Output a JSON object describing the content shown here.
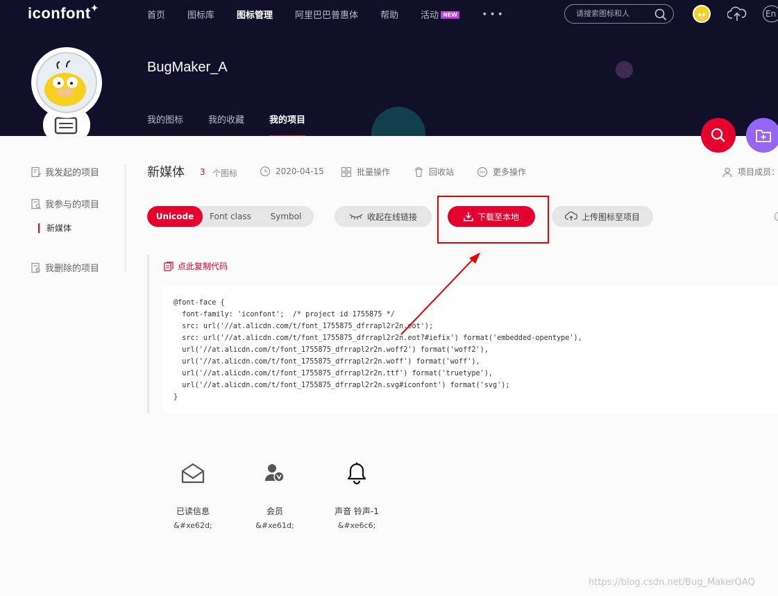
{
  "header": {
    "logo": "iconfont",
    "nav": [
      {
        "label": "首页"
      },
      {
        "label": "图标库"
      },
      {
        "label": "图标管理",
        "active": true
      },
      {
        "label": "阿里巴巴普惠体"
      },
      {
        "label": "帮助"
      },
      {
        "label": "活动"
      }
    ],
    "new_badge": "NEW",
    "more": "•••",
    "search_placeholder": "请搜索图标和人",
    "lang": "En"
  },
  "profile": {
    "username": "BugMaker_A",
    "tabs": [
      {
        "label": "我的图标"
      },
      {
        "label": "我的收藏"
      },
      {
        "label": "我的项目",
        "active": true
      }
    ]
  },
  "sidebar": {
    "items": [
      {
        "label": "我发起的项目"
      },
      {
        "label": "我参与的项目"
      },
      {
        "label": "我删除的项目"
      }
    ],
    "current_project": "新媒体"
  },
  "project": {
    "name": "新媒体",
    "icon_count": "3",
    "icon_count_label": "个图标",
    "date": "2020-04-15",
    "batch_ops": "批量操作",
    "recycle": "回收站",
    "more_ops": "更多操作",
    "members": "项目成员："
  },
  "toolbar": {
    "modes": [
      "Unicode",
      "Font class",
      "Symbol"
    ],
    "active_mode": "Unicode",
    "collapse_link": "收起在线链接",
    "download": "下载至本地",
    "upload": "上传图标至项目"
  },
  "code": {
    "copy_label": "点此复制代码",
    "snippet": "@font-face {\n  font-family: 'iconfont';  /* project id 1755875 */\n  src: url('//at.alicdn.com/t/font_1755875_dfrrapl2r2n.eot');\n  src: url('//at.alicdn.com/t/font_1755875_dfrrapl2r2n.eot?#iefix') format('embedded-opentype'),\n  url('//at.alicdn.com/t/font_1755875_dfrrapl2r2n.woff2') format('woff2'),\n  url('//at.alicdn.com/t/font_1755875_dfrrapl2r2n.woff') format('woff'),\n  url('//at.alicdn.com/t/font_1755875_dfrrapl2r2n.ttf') format('truetype'),\n  url('//at.alicdn.com/t/font_1755875_dfrrapl2r2n.svg#iconfont') format('svg');\n}"
  },
  "icons": [
    {
      "name": "已读信息",
      "code": "&#xe62d;",
      "icon": "envelope-open-icon"
    },
    {
      "name": "会员",
      "code": "&#xe61d;",
      "icon": "member-icon"
    },
    {
      "name": "声音 铃声-1",
      "code": "&#xe6c6;",
      "icon": "bell-icon"
    }
  ],
  "watermark": "https://blog.csdn.net/Bug_MakerQAQ",
  "colors": {
    "accent": "#e6002d",
    "header_bg": "#11102a",
    "annotation": "#e30000",
    "fab_purple": "#9566f4"
  }
}
